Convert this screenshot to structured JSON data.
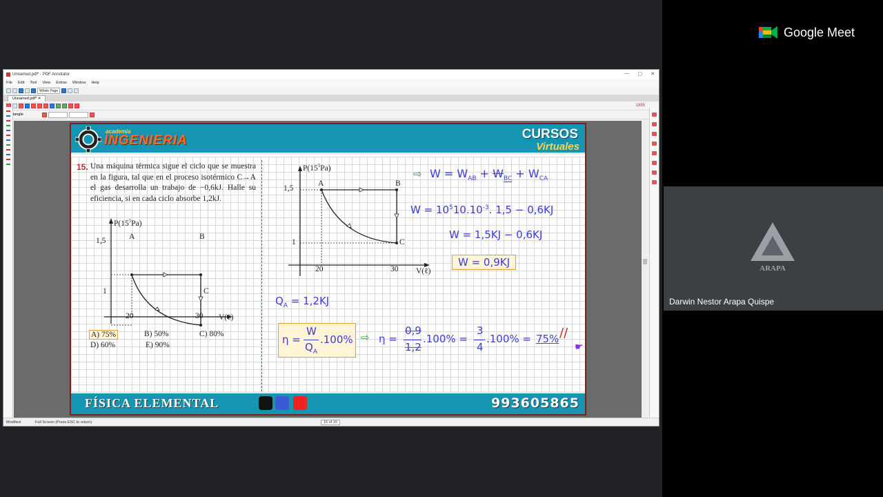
{
  "meet": {
    "brand": "Google Meet",
    "participant_name": "Darwin Nestor Arapa Quispe",
    "tile_logo_text": "ARAPA"
  },
  "app": {
    "window_title": "Unnamed.pdf* - PDF Annotator",
    "menu": [
      "File",
      "Edit",
      "Tool",
      "View",
      "Extras",
      "Window",
      "Help"
    ],
    "zoom": "Whole Page",
    "tool_name": "Rectangle",
    "tab": "Unnamed.pdf*",
    "status_left": "Modified",
    "status_mode": "Full Screen (Press ESC to return)",
    "page_indicator": "16 of 16",
    "badge": "1895"
  },
  "doc": {
    "header_small": "academia",
    "header_brand": "INGENIERIA",
    "header_right_1": "CURSOS",
    "header_right_2": "Virtuales",
    "footer_left": "FÍSICA ELEMENTAL",
    "footer_right": "993605865",
    "question_number": "15.",
    "question_text": "Una máquina térmica sigue el ciclo que se muestra en la figura, tal que en el proceso isotérmico C→A el gas desarrolla un trabajo de −0,6kJ. Halle su eficiencia, si en cada ciclo absorbe 1,2kJ.",
    "options": {
      "a": "A) 75%",
      "b": "B) 50%",
      "c": "C) 80%",
      "d": "D) 60%",
      "e": "E) 90%"
    },
    "graph": {
      "ylabel_p": "P(15",
      "ylabel_exp": "5",
      "ylabel_unit": "Pa)",
      "xlabel": "V(ℓ)",
      "y_ticks": [
        "1,5",
        "1"
      ],
      "x_ticks": [
        "20",
        "30"
      ],
      "points": [
        "A",
        "B",
        "C"
      ]
    },
    "work": {
      "line1_w": "W = W",
      "line1_ab": "AB",
      "line1_bc": "BC",
      "line1_ca": "CA",
      "line2": "W = 10",
      "line2_exp": "5",
      "line2_rest": "10.10",
      "line2_exp2": "-3",
      "line2_tail": ". 1,5 − 0,6KJ",
      "line3": "W = 1,5KJ − 0,6KJ",
      "line4": "W = 0,9KJ",
      "line5": "Q",
      "line5_sub": "A",
      "line5_rest": "= 1,2KJ",
      "eff_eta": "η =",
      "eff_num": "W",
      "eff_den": "Q",
      "eff_den_sub": "A",
      "eff_mult": ".100%",
      "calc_eta": "η =",
      "calc_num": "0,9",
      "calc_den": "1,2",
      "calc_mid": ".100% =",
      "calc_num2": "3",
      "calc_den2": "4",
      "calc_mid2": ".100% =",
      "calc_result": "75%"
    }
  }
}
